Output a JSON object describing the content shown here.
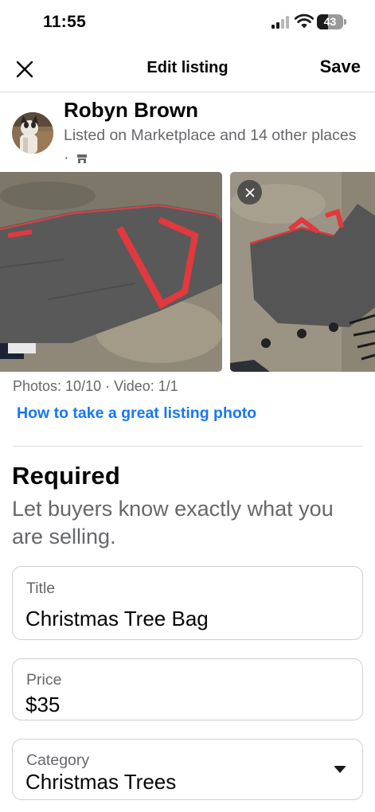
{
  "status_bar": {
    "time": "11:55",
    "battery_level": "43"
  },
  "nav": {
    "title": "Edit listing",
    "save_label": "Save"
  },
  "seller": {
    "name": "Robyn Brown",
    "listed_text": "Listed on Marketplace and 14 other places ·"
  },
  "photos": {
    "count_text": "Photos: 10/10 · Video: 1/1",
    "tip_link": "How to take a great listing photo"
  },
  "required": {
    "heading": "Required",
    "subtitle": "Let buyers know exactly what you are selling."
  },
  "fields": {
    "title": {
      "label": "Title",
      "value": "Christmas Tree Bag"
    },
    "price": {
      "label": "Price",
      "value": "$35"
    },
    "category": {
      "label": "Category",
      "value": "Christmas Trees"
    }
  },
  "colors": {
    "accent": "#1877f2",
    "secondary_text": "#65676b",
    "border": "#ced0d4"
  },
  "icons": [
    "close-icon",
    "signal-icon",
    "wifi-icon",
    "battery-icon",
    "shop-icon",
    "remove-photo-icon",
    "chevron-down-icon"
  ]
}
